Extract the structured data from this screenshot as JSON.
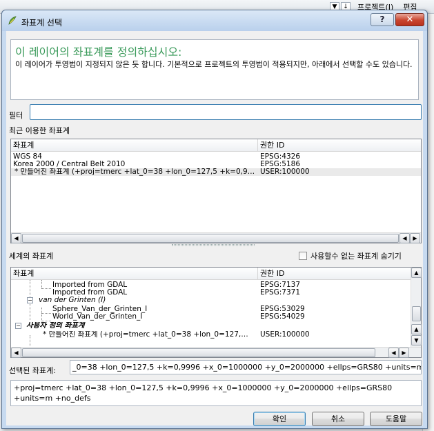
{
  "background": {
    "menu": [
      "프로젝트(J)",
      "편집"
    ]
  },
  "dialog": {
    "title": "좌표계 선택",
    "help_label": "?",
    "close_label": "✕",
    "message_heading": "이 레이어의 좌표계를 정의하십시오:",
    "message_body": "이 레이어가 투영법이 지정되지 않은 듯 합니다. 기본적으로 프로젝트의 투영법이 적용되지만, 아래에서 선택할 수도 있습니다.",
    "filter_label": "필터",
    "filter_value": "",
    "recent_label": "최근 이용한 좌표계",
    "recent_table": {
      "columns": [
        "좌표계",
        "권한 ID"
      ],
      "rows": [
        [
          "WGS 84",
          "EPSG:4326"
        ],
        [
          "Korea 2000 / Central Belt 2010",
          "EPSG:5186"
        ],
        [
          "* 만들어진 좌표계 (+proj=tmerc +lat_0=38 +lon_0=127,5 +k=0,9…",
          "USER:100000"
        ]
      ]
    },
    "world_label": "세계의 좌표계",
    "hide_deprecated_label": "사용할수 없는 좌표계 숨기기",
    "world_table": {
      "columns": [
        "좌표계",
        "권한 ID"
      ],
      "rows": [
        [
          "Imported from GDAL",
          "EPSG:7137"
        ],
        [
          "Imported from GDAL",
          "EPSG:7371"
        ],
        [
          "van der Grinten (I)",
          ""
        ],
        [
          "Sphere_Van_der_Grinten_I",
          "EPSG:53029"
        ],
        [
          "World_Van_der_Grinten_I",
          "EPSG:54029"
        ],
        [
          "사용자 정의 좌표계",
          ""
        ],
        [
          "* 만들어진 좌표계 (+proj=tmerc +lat_0=38 +lon_0=127,…",
          "USER:100000"
        ]
      ]
    },
    "selected_label": "선택된 좌표계:",
    "selected_value": "_0=38 +lon_0=127,5 +k=0,9996 +x_0=1000000 +y_0=2000000 +ellps=GRS80 +units=m +no_defs)",
    "proj_string": "+proj=tmerc +lat_0=38 +lon_0=127,5 +k=0,9996 +x_0=1000000 +y_0=2000000 +ellps=GRS80 +units=m +no_defs",
    "buttons": {
      "ok": "확인",
      "cancel": "취소",
      "help": "도움말"
    }
  },
  "colors": {
    "heading_green": "#3a9a5a",
    "title_gradient_top": "#dbe8f7",
    "close_red": "#c9452f"
  }
}
